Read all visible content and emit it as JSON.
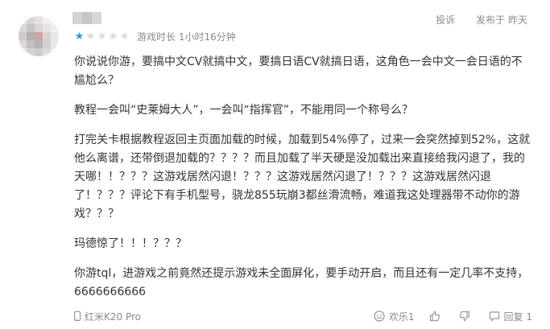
{
  "review": {
    "rating": 1,
    "max_rating": 5,
    "star_filled_color": "#1a9fd6",
    "star_empty_color": "#d9d9d9",
    "star_glyph": "★",
    "playtime": "游戏时长 1小时16分钟",
    "report_label": "投诉",
    "posted_label": "发布于 昨天",
    "paragraphs": [
      "你说说你游，要搞中文CV就搞中文，要搞日语CV就搞日语，这角色一会中文一会日语的不尴尬么？",
      "教程一会叫“史莱姆大人”，一会叫“指挥官”，不能用同一个称号么？",
      "打完关卡根据教程返回主页面加载的时候，加载到54%停了，过来一会突然掉到52%，这就他么离谱，还带倒退加载的？？？？而且加载了半天硬是没加载出来直接给我闪退了，我的天哪！！？？？这游戏居然闪退！？？？这游戏居然闪退了！？？？这游戏居然闪退了！？？？评论下有手机型号，骁龙855玩崩3都丝滑流畅，难道我这处理器带不动你的游戏？？？",
      "玛德惊了！！！？？？",
      "你游tql，进游戏之前竟然还提示游戏未全面屏化，要手动开启，而且还有一定几率不支持，6666666666"
    ],
    "device": "红米K20 Pro",
    "like_label": "欢乐1",
    "reply_label": "回复 1"
  }
}
